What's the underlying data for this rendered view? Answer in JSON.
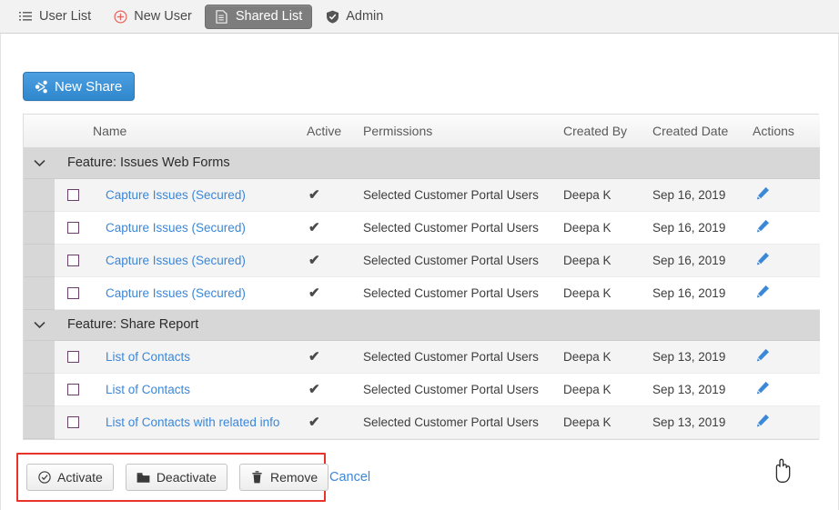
{
  "nav": {
    "items": [
      {
        "label": "User List",
        "icon": "list-icon",
        "active": false
      },
      {
        "label": "New User",
        "icon": "plus-circle-icon",
        "active": false
      },
      {
        "label": "Shared List",
        "icon": "document-icon",
        "active": true
      },
      {
        "label": "Admin",
        "icon": "shield-check-icon",
        "active": false
      }
    ]
  },
  "toolbar": {
    "new_share_label": "New Share",
    "new_share_icon": "share-icon",
    "new_share_color": "#3a8ed0"
  },
  "table": {
    "headers": {
      "name": "Name",
      "active": "Active",
      "permissions": "Permissions",
      "created_by": "Created By",
      "created_date": "Created Date",
      "actions": "Actions"
    },
    "groups": [
      {
        "label": "Feature: Issues Web Forms",
        "expanded": true,
        "chevron": "chevron-down-icon",
        "rows": [
          {
            "checked": false,
            "name": "Capture Issues (Secured)",
            "active": "✔",
            "permissions": "Selected Customer Portal Users",
            "created_by": "Deepa K",
            "created_date": "Sep 16, 2019",
            "action": "edit-pencil-icon"
          },
          {
            "checked": false,
            "name": "Capture Issues (Secured)",
            "active": "✔",
            "permissions": "Selected Customer Portal Users",
            "created_by": "Deepa K",
            "created_date": "Sep 16, 2019",
            "action": "edit-pencil-icon"
          },
          {
            "checked": false,
            "name": "Capture Issues (Secured)",
            "active": "✔",
            "permissions": "Selected Customer Portal Users",
            "created_by": "Deepa K",
            "created_date": "Sep 16, 2019",
            "action": "edit-pencil-icon"
          },
          {
            "checked": false,
            "name": "Capture Issues (Secured)",
            "active": "✔",
            "permissions": "Selected Customer Portal Users",
            "created_by": "Deepa K",
            "created_date": "Sep 16, 2019",
            "action": "edit-pencil-icon"
          }
        ]
      },
      {
        "label": "Feature: Share Report",
        "expanded": true,
        "chevron": "chevron-down-icon",
        "rows": [
          {
            "checked": false,
            "name": "List of Contacts",
            "active": "✔",
            "permissions": "Selected Customer Portal Users",
            "created_by": "Deepa K",
            "created_date": "Sep 13, 2019",
            "action": "edit-pencil-icon"
          },
          {
            "checked": false,
            "name": "List of Contacts",
            "active": "✔",
            "permissions": "Selected Customer Portal Users",
            "created_by": "Deepa K",
            "created_date": "Sep 13, 2019",
            "action": "edit-pencil-icon"
          },
          {
            "checked": false,
            "name": "List of Contacts with related info",
            "active": "✔",
            "permissions": "Selected Customer Portal Users",
            "created_by": "Deepa K",
            "created_date": "Sep 13, 2019",
            "action": "edit-pencil-icon"
          }
        ]
      }
    ]
  },
  "action_bar": {
    "highlight_color": "#e8322a",
    "buttons": [
      {
        "label": "Activate",
        "icon": "check-circle-icon"
      },
      {
        "label": "Deactivate",
        "icon": "archive-box-icon"
      },
      {
        "label": "Remove",
        "icon": "trash-icon"
      }
    ],
    "cancel_label": "Cancel"
  },
  "colors": {
    "link": "#3b87d8",
    "active_tab_bg": "#7d7d7d",
    "group_row_bg": "#d7d7d7"
  }
}
